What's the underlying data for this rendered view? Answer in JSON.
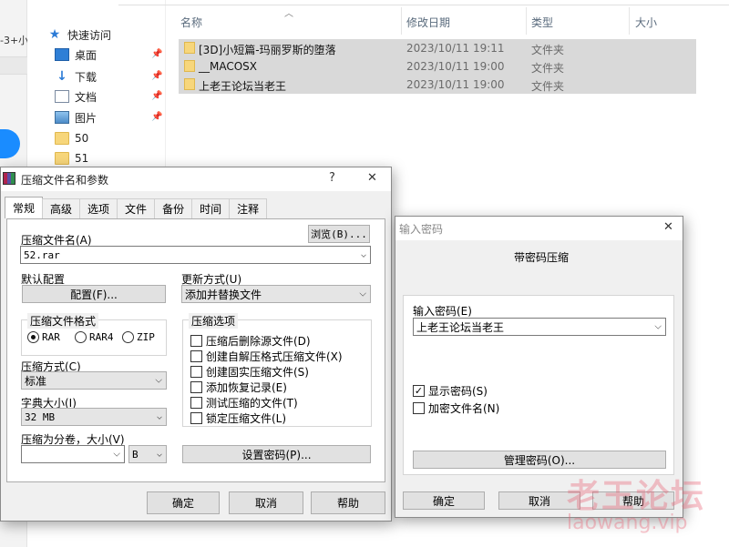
{
  "explorer": {
    "tab_fragment": "-3+小",
    "nav": [
      {
        "label": "快速访问",
        "icon": "star-icon"
      },
      {
        "label": "桌面",
        "icon": "desktop-icon"
      },
      {
        "label": "下载",
        "icon": "download-icon"
      },
      {
        "label": "文档",
        "icon": "document-icon"
      },
      {
        "label": "图片",
        "icon": "picture-icon"
      },
      {
        "label": "50",
        "icon": "folder-icon"
      },
      {
        "label": "51",
        "icon": "folder-icon"
      }
    ],
    "columns": {
      "name": "名称",
      "date": "修改日期",
      "type": "类型",
      "size": "大小"
    },
    "files": [
      {
        "name": "[3D]小短篇-玛丽罗斯的堕落",
        "date": "2023/10/11 19:11",
        "type": "文件夹"
      },
      {
        "name": "__MACOSX",
        "date": "2023/10/11 19:00",
        "type": "文件夹"
      },
      {
        "name": "上老王论坛当老王",
        "date": "2023/10/11 19:00",
        "type": "文件夹"
      }
    ]
  },
  "archive_dialog": {
    "title": "压缩文件名和参数",
    "help_glyph": "?",
    "close_glyph": "✕",
    "tabs": [
      "常规",
      "高级",
      "选项",
      "文件",
      "备份",
      "时间",
      "注释"
    ],
    "archive_name_label": "压缩文件名(A)",
    "browse_label": "浏览(B)...",
    "archive_name_value": "52.rar",
    "default_profile_label": "默认配置",
    "profile_button": "配置(F)...",
    "update_mode_label": "更新方式(U)",
    "update_mode_value": "添加并替换文件",
    "format_group": "压缩文件格式",
    "formats": [
      "RAR",
      "RAR4",
      "ZIP"
    ],
    "options_group": "压缩选项",
    "options": [
      "压缩后删除源文件(D)",
      "创建自解压格式压缩文件(X)",
      "创建固实压缩文件(S)",
      "添加恢复记录(E)",
      "测试压缩的文件(T)",
      "锁定压缩文件(L)"
    ],
    "method_label": "压缩方式(C)",
    "method_value": "标准",
    "dict_label": "字典大小(I)",
    "dict_value": "32 MB",
    "split_label": "压缩为分卷，大小(V)",
    "split_value": "",
    "split_unit": "B",
    "set_password_button": "设置密码(P)...",
    "ok": "确定",
    "cancel": "取消",
    "help": "帮助"
  },
  "password_dialog": {
    "title": "输入密码",
    "close_glyph": "✕",
    "header": "带密码压缩",
    "password_label": "输入密码(E)",
    "password_value": "上老王论坛当老王",
    "show_password": "显示密码(S)",
    "encrypt_names": "加密文件名(N)",
    "manage_button": "管理密码(O)...",
    "ok": "确定",
    "cancel": "取消",
    "help": "帮助",
    "show_password_checked": true,
    "encrypt_names_checked": false
  },
  "watermark": {
    "line1": "老王论坛",
    "line2": "laowang.vip"
  }
}
